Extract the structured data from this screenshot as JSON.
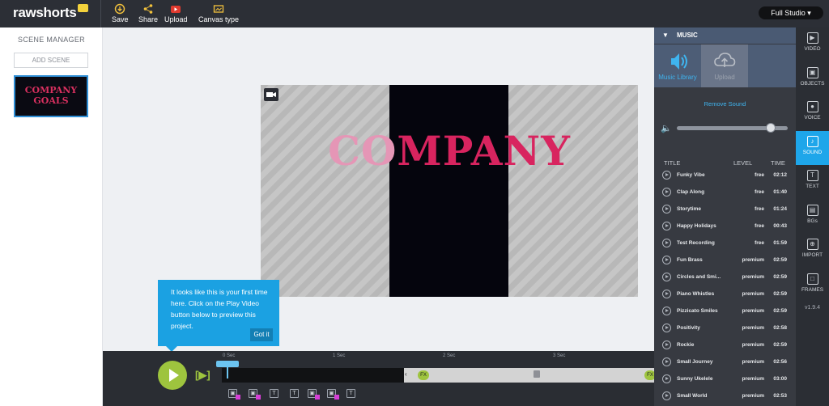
{
  "topbar": {
    "logo": "rawshorts",
    "tools": [
      {
        "label": "Save",
        "icon": "save-icon"
      },
      {
        "label": "Share",
        "icon": "share-icon"
      },
      {
        "label": "Upload",
        "icon": "youtube-icon"
      },
      {
        "label": "Canvas type",
        "icon": "canvas-icon"
      }
    ],
    "mode_label": "Full Studio"
  },
  "scene_manager": {
    "title": "SCENE MANAGER",
    "add_label": "ADD SCENE",
    "thumb_line1": "COMPANY",
    "thumb_line2": "GOALS"
  },
  "stage": {
    "title_light_1": "CO",
    "title_dark": "MPANY",
    "title_light_2": "Y"
  },
  "tooltip": {
    "text": "It looks like this is your first time here. Click on the Play Video button below to preview this project.",
    "button": "Got it"
  },
  "timeline": {
    "ticks": [
      "0 Sec",
      "1 Sec",
      "2 Sec",
      "3 Sec"
    ],
    "preview_label": "[▶]",
    "fx_label": "FX"
  },
  "music": {
    "header": "MUSIC",
    "tabs": [
      {
        "label": "Music Library",
        "active": true
      },
      {
        "label": "Upload",
        "active": false
      }
    ],
    "remove_label": "Remove Sound",
    "volume_level": 0.85,
    "columns": {
      "title": "TITLE",
      "level": "LEVEL",
      "time": "TIME"
    },
    "songs": [
      {
        "title": "Funky Vibe",
        "level": "free",
        "time": "02:12"
      },
      {
        "title": "Clap Along",
        "level": "free",
        "time": "01:40"
      },
      {
        "title": "Storytime",
        "level": "free",
        "time": "01:24"
      },
      {
        "title": "Happy Holidays",
        "level": "free",
        "time": "00:43"
      },
      {
        "title": "Test Recording",
        "level": "free",
        "time": "01:59"
      },
      {
        "title": "Fun Brass",
        "level": "premium",
        "time": "02:59"
      },
      {
        "title": "Circles and Smi...",
        "level": "premium",
        "time": "02:59"
      },
      {
        "title": "Piano Whistles",
        "level": "premium",
        "time": "02:59"
      },
      {
        "title": "Pizzicato Smiles",
        "level": "premium",
        "time": "02:59"
      },
      {
        "title": "Positivity",
        "level": "premium",
        "time": "02:58"
      },
      {
        "title": "Rockie",
        "level": "premium",
        "time": "02:59"
      },
      {
        "title": "Small Journey",
        "level": "premium",
        "time": "02:56"
      },
      {
        "title": "Sunny Ukelele",
        "level": "premium",
        "time": "03:00"
      },
      {
        "title": "Small World",
        "level": "premium",
        "time": "02:53"
      }
    ]
  },
  "rail": {
    "items": [
      {
        "label": "VIDEO",
        "glyph": "▶"
      },
      {
        "label": "OBJECTS",
        "glyph": "▣"
      },
      {
        "label": "VOICE",
        "glyph": "●"
      },
      {
        "label": "SOUND",
        "glyph": "♪",
        "active": true
      },
      {
        "label": "TEXT",
        "glyph": "T"
      },
      {
        "label": "BGs",
        "glyph": "▤"
      },
      {
        "label": "IMPORT",
        "glyph": "⊕"
      },
      {
        "label": "FRAMES",
        "glyph": "□"
      }
    ],
    "version": "v1.9.4"
  },
  "colors": {
    "accent_blue": "#1ea6ea",
    "play_green": "#9ec43e",
    "brand_pink": "#d8245f"
  }
}
